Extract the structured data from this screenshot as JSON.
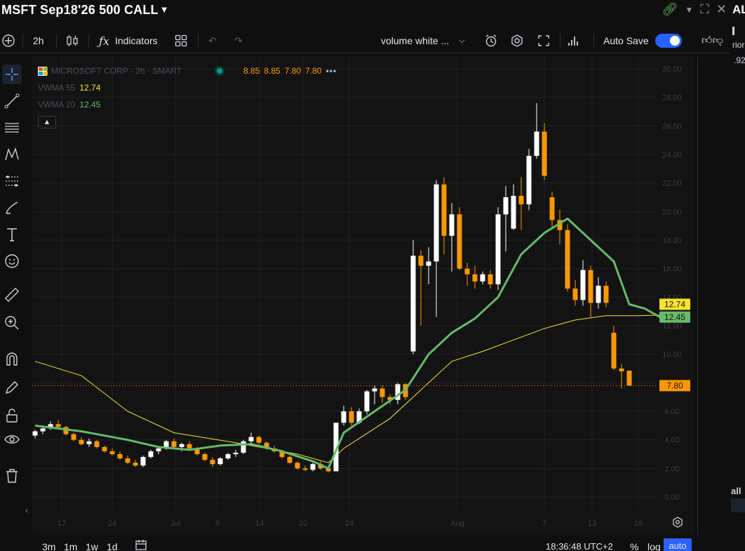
{
  "titlebar": {
    "title": "MSFT Sep18'26 500 CALL"
  },
  "toolbar": {
    "interval": "2h",
    "indicators_label": "Indicators",
    "layout_name": "volume white ...",
    "auto_save_label": "Auto Save"
  },
  "legend": {
    "symbol_text": "MICROSOFT CORP · 2h · SMART",
    "ohlc": [
      "8.85",
      "8.85",
      "7.80",
      "7.80"
    ],
    "vwma55_label": "VWMA 55",
    "vwma55_value": "12.74",
    "vwma20_label": "VWMA 20",
    "vwma20_value": "12.45"
  },
  "price_axis": {
    "ticks": [
      "30.00",
      "28.00",
      "26.00",
      "24.00",
      "22.00",
      "20.00",
      "18.00",
      "16.00",
      "14.00",
      "12.00",
      "10.00",
      "8.00",
      "6.00",
      "4.00",
      "2.00",
      "0.00"
    ],
    "labels": {
      "vwma55": "12.74",
      "vwma20": "12.45",
      "last": "7.80"
    }
  },
  "time_axis": {
    "ticks": [
      "17",
      "24",
      "Jul",
      "8",
      "14",
      "20",
      "24",
      "Aug",
      "7",
      "13",
      "18"
    ]
  },
  "bottombar": {
    "ranges": [
      "3m",
      "1m",
      "1w",
      "1d"
    ],
    "clock": "18:36:48 UTC+2",
    "percent_label": "%",
    "log_label": "log",
    "auto_label": "auto"
  },
  "edge": {
    "top_text": "AL",
    "t2": "rior",
    "t3": ".92",
    "t4": "all"
  },
  "colors": {
    "up": "#ffffff",
    "down": "#ff9800",
    "vwma20": "#66bb6a",
    "vwma55": "#f8e42f",
    "accent": "#2962ff",
    "bg": "#131313"
  },
  "chart_data": {
    "type": "candlestick",
    "ylim": [
      0,
      30
    ],
    "y_ticks": [
      30,
      28,
      26,
      24,
      22,
      20,
      18,
      16,
      14,
      12,
      10,
      8,
      6,
      4,
      2,
      0
    ],
    "last_price": 7.8,
    "candles": [
      [
        4.3,
        4.7,
        4.1,
        4.6
      ],
      [
        4.6,
        5.0,
        4.4,
        4.8
      ],
      [
        4.8,
        5.3,
        4.7,
        5.1
      ],
      [
        5.1,
        5.4,
        4.8,
        4.9
      ],
      [
        4.9,
        5.0,
        4.3,
        4.4
      ],
      [
        4.4,
        4.5,
        3.9,
        4.0
      ],
      [
        4.0,
        4.2,
        3.6,
        3.7
      ],
      [
        3.7,
        4.1,
        3.5,
        3.9
      ],
      [
        3.9,
        4.0,
        3.4,
        3.5
      ],
      [
        3.5,
        3.6,
        3.1,
        3.2
      ],
      [
        3.2,
        3.4,
        2.9,
        3.0
      ],
      [
        3.0,
        3.2,
        2.6,
        2.7
      ],
      [
        2.7,
        2.9,
        2.3,
        2.4
      ],
      [
        2.4,
        2.6,
        2.1,
        2.2
      ],
      [
        2.2,
        2.9,
        2.1,
        2.8
      ],
      [
        2.8,
        3.3,
        2.7,
        3.2
      ],
      [
        3.2,
        3.5,
        3.0,
        3.4
      ],
      [
        3.4,
        4.0,
        3.3,
        3.9
      ],
      [
        3.9,
        4.1,
        3.4,
        3.5
      ],
      [
        3.5,
        3.8,
        3.2,
        3.7
      ],
      [
        3.7,
        3.9,
        3.3,
        3.4
      ],
      [
        3.4,
        3.5,
        2.9,
        3.0
      ],
      [
        3.0,
        3.1,
        2.5,
        2.6
      ],
      [
        2.6,
        2.8,
        2.1,
        2.3
      ],
      [
        2.3,
        2.8,
        2.2,
        2.7
      ],
      [
        2.7,
        3.1,
        2.6,
        3.0
      ],
      [
        3.0,
        3.3,
        2.8,
        3.1
      ],
      [
        3.1,
        4.0,
        3.0,
        3.9
      ],
      [
        3.9,
        4.5,
        3.6,
        4.2
      ],
      [
        4.2,
        4.3,
        3.7,
        3.8
      ],
      [
        3.8,
        3.9,
        3.3,
        3.4
      ],
      [
        3.4,
        3.6,
        3.1,
        3.2
      ],
      [
        3.2,
        3.3,
        2.7,
        2.8
      ],
      [
        2.8,
        2.9,
        2.3,
        2.4
      ],
      [
        2.4,
        2.5,
        1.9,
        2.0
      ],
      [
        2.0,
        2.2,
        1.8,
        1.9
      ],
      [
        1.9,
        2.4,
        1.8,
        2.3
      ],
      [
        2.3,
        2.5,
        1.9,
        2.0
      ],
      [
        2.0,
        2.2,
        1.7,
        1.8
      ],
      [
        1.8,
        5.2,
        1.8,
        5.2
      ],
      [
        5.2,
        6.4,
        5.0,
        6.0
      ],
      [
        6.0,
        6.3,
        5.0,
        5.2
      ],
      [
        5.2,
        6.2,
        5.1,
        6.0
      ],
      [
        6.0,
        7.5,
        5.8,
        7.4
      ],
      [
        7.4,
        7.8,
        6.5,
        7.6
      ],
      [
        7.6,
        7.8,
        6.6,
        7.0
      ],
      [
        7.0,
        7.2,
        6.5,
        6.8
      ],
      [
        6.8,
        8.0,
        6.5,
        7.9
      ],
      [
        7.9,
        8.0,
        6.8,
        7.0
      ],
      [
        10.2,
        18.0,
        10.0,
        16.9
      ],
      [
        16.9,
        17.3,
        12.0,
        16.2
      ],
      [
        16.2,
        17.5,
        14.9,
        16.5
      ],
      [
        16.5,
        22.2,
        12.6,
        21.9
      ],
      [
        21.9,
        22.4,
        17.0,
        18.3
      ],
      [
        18.3,
        20.6,
        15.8,
        19.8
      ],
      [
        19.8,
        20.3,
        15.9,
        16.0
      ],
      [
        16.0,
        16.4,
        14.8,
        15.6
      ],
      [
        15.6,
        16.2,
        14.6,
        15.1
      ],
      [
        15.1,
        15.8,
        14.9,
        15.6
      ],
      [
        15.6,
        15.9,
        14.6,
        14.9
      ],
      [
        14.9,
        20.3,
        14.5,
        19.8
      ],
      [
        19.8,
        21.8,
        17.2,
        21.0
      ],
      [
        18.8,
        21.9,
        18.7,
        21.1
      ],
      [
        21.1,
        22.4,
        18.7,
        20.5
      ],
      [
        20.5,
        24.4,
        20.1,
        23.9
      ],
      [
        23.9,
        27.6,
        23.7,
        25.6
      ],
      [
        25.6,
        26.2,
        22.2,
        22.5
      ],
      [
        21.0,
        21.4,
        18.9,
        19.4
      ],
      [
        19.4,
        20.1,
        17.7,
        18.7
      ],
      [
        18.7,
        19.1,
        14.4,
        14.6
      ],
      [
        14.6,
        15.2,
        13.4,
        13.8
      ],
      [
        13.8,
        16.6,
        13.4,
        15.9
      ],
      [
        15.9,
        16.2,
        12.6,
        13.6
      ],
      [
        13.6,
        15.4,
        13.2,
        14.8
      ],
      [
        14.8,
        15.1,
        13.3,
        13.6
      ],
      [
        11.5,
        12.0,
        8.9,
        9.0
      ],
      [
        9.0,
        9.3,
        7.6,
        8.8
      ],
      [
        8.85,
        8.85,
        7.8,
        7.8
      ]
    ],
    "series": [
      {
        "name": "VWMA 20",
        "points": [
          [
            0,
            5.0
          ],
          [
            6,
            4.6
          ],
          [
            12,
            4.0
          ],
          [
            16,
            3.5
          ],
          [
            20,
            3.3
          ],
          [
            24,
            3.6
          ],
          [
            28,
            3.7
          ],
          [
            32,
            3.2
          ],
          [
            36,
            2.5
          ],
          [
            38,
            2.0
          ],
          [
            40,
            4.5
          ],
          [
            44,
            6.0
          ],
          [
            48,
            7.5
          ],
          [
            51,
            10.0
          ],
          [
            54,
            11.5
          ],
          [
            57,
            12.5
          ],
          [
            60,
            14.0
          ],
          [
            63,
            17.0
          ],
          [
            66,
            18.5
          ],
          [
            69,
            19.5
          ],
          [
            72,
            18.0
          ],
          [
            75,
            16.5
          ],
          [
            77,
            13.5
          ],
          [
            79,
            13.2
          ],
          [
            81,
            12.6
          ]
        ]
      },
      {
        "name": "VWMA 55",
        "points": [
          [
            0,
            9.5
          ],
          [
            6,
            8.5
          ],
          [
            12,
            6.0
          ],
          [
            18,
            4.5
          ],
          [
            26,
            3.8
          ],
          [
            34,
            3.0
          ],
          [
            38,
            2.4
          ],
          [
            40,
            3.4
          ],
          [
            46,
            5.5
          ],
          [
            50,
            7.5
          ],
          [
            54,
            9.5
          ],
          [
            58,
            10.2
          ],
          [
            62,
            11.0
          ],
          [
            66,
            11.8
          ],
          [
            70,
            12.4
          ],
          [
            74,
            12.7
          ],
          [
            78,
            12.7
          ],
          [
            81,
            12.74
          ]
        ]
      }
    ]
  }
}
